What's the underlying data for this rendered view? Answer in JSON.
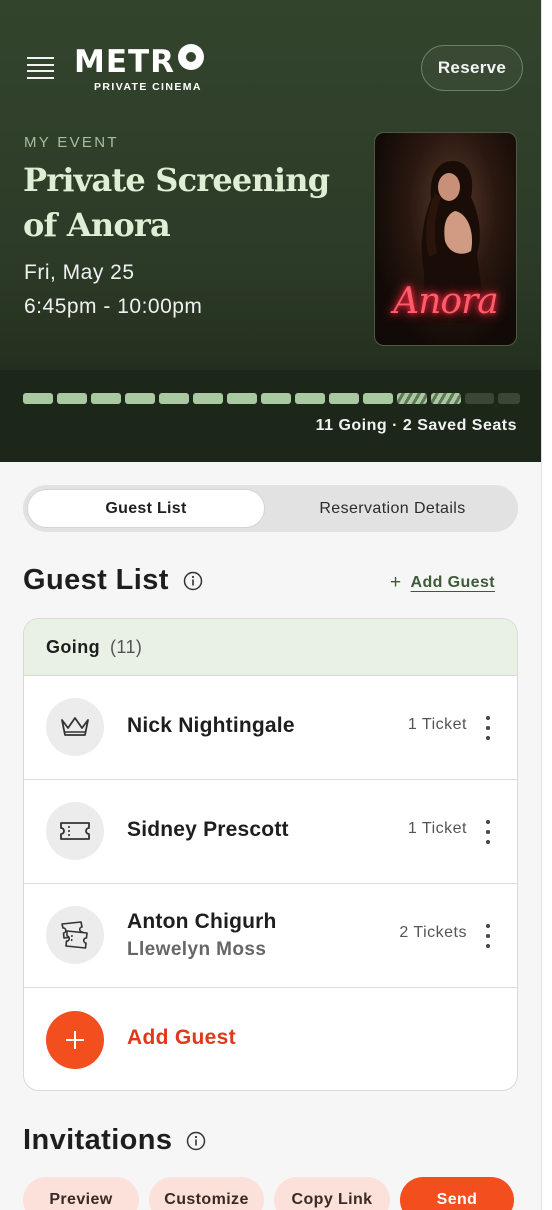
{
  "header": {
    "logo_main": "METR",
    "logo_sub": "PRIVATE CINEMA",
    "reserve_label": "Reserve"
  },
  "event": {
    "eyebrow": "MY EVENT",
    "title": "Private Screening of Anora",
    "date": "Fri, May 25",
    "time": "6:45pm - 10:00pm",
    "poster_title": "Anora"
  },
  "progress": {
    "summary": "11 Going · 2 Saved Seats",
    "going": 11,
    "saved": 2,
    "total_seats": 15
  },
  "tabs": {
    "active": "Guest List",
    "inactive": "Reservation Details"
  },
  "guest_section": {
    "title": "Guest List",
    "add_link": "Add Guest",
    "group_label": "Going",
    "group_count": "(11)",
    "guests": [
      {
        "name": "Nick Nightingale",
        "sub": "",
        "tickets": "1 Ticket",
        "icon": "crown-icon"
      },
      {
        "name": "Sidney Prescott",
        "sub": "",
        "tickets": "1 Ticket",
        "icon": "ticket-icon"
      },
      {
        "name": "Anton Chigurh",
        "sub": "Llewelyn Moss",
        "tickets": "2 Tickets",
        "icon": "tickets-icon"
      }
    ],
    "add_row_label": "Add Guest"
  },
  "invitations": {
    "title": "Invitations",
    "actions": [
      "Preview",
      "Customize",
      "Copy Link",
      "Send"
    ]
  },
  "colors": {
    "hero_green": "#33442d",
    "accent_orange": "#f24e1e",
    "seat_green": "#a9c9a0",
    "title_green": "#dfeed5"
  }
}
